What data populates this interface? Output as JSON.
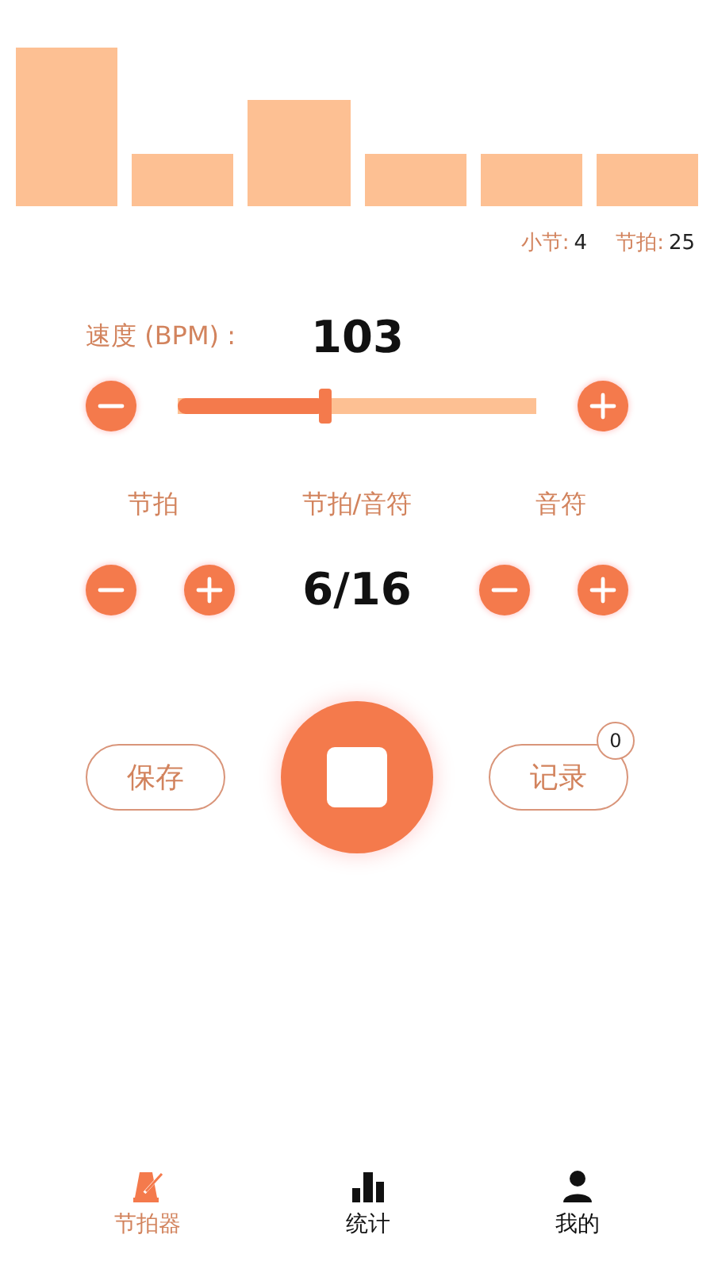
{
  "beat_bars": [
    {
      "kind": "accent"
    },
    {
      "kind": "normal"
    },
    {
      "kind": "medium"
    },
    {
      "kind": "normal"
    },
    {
      "kind": "normal"
    },
    {
      "kind": "normal"
    }
  ],
  "counters": [
    {
      "label": "小节:",
      "value": "4"
    },
    {
      "label": "节拍:",
      "value": "25"
    }
  ],
  "tempo": {
    "label": "速度 (BPM) :",
    "value": "103",
    "level": 0.41
  },
  "meter": {
    "labels": [
      "节拍",
      "节拍/音符",
      "音符"
    ],
    "value": "6/16"
  },
  "actions": {
    "save": "保存",
    "record": "记录",
    "record_count": "0",
    "playing": true
  },
  "nav": [
    {
      "label": "节拍器",
      "selected": true
    },
    {
      "label": "统计",
      "selected": false
    },
    {
      "label": "我的",
      "selected": false
    }
  ]
}
